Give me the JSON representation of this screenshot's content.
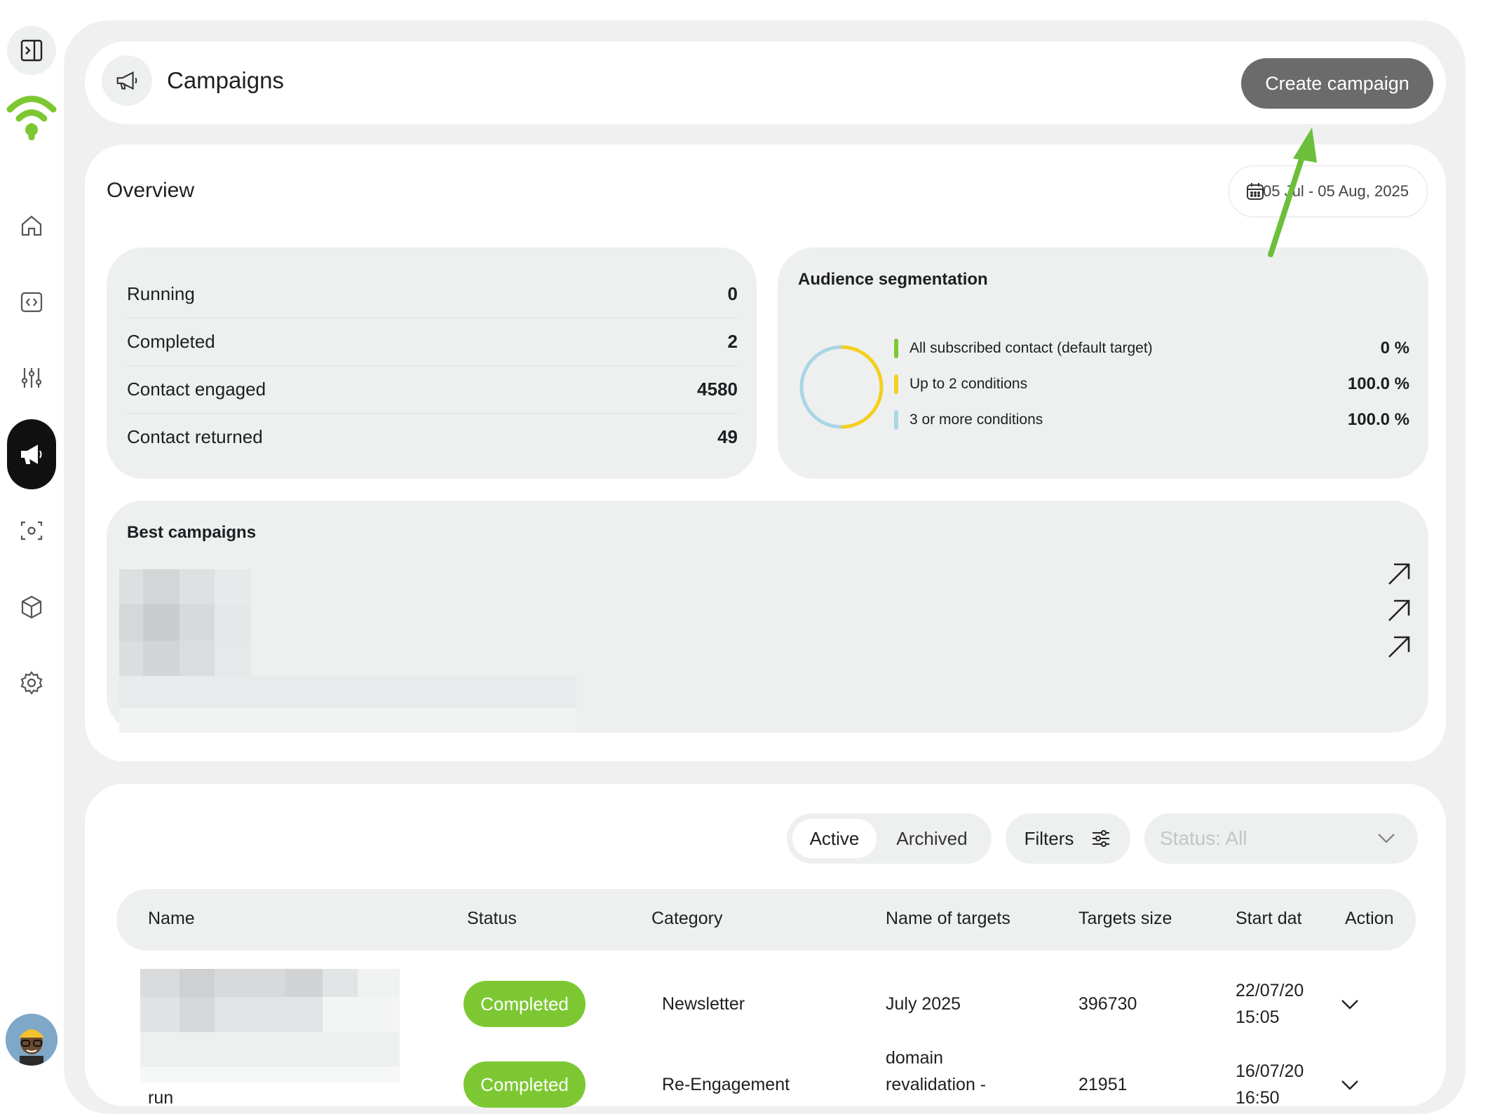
{
  "sidebar": {
    "toggle_icon": "sidebar-toggle-icon",
    "logo_icon": "wifi-logo-icon",
    "items": [
      {
        "name": "home",
        "icon": "home-icon"
      },
      {
        "name": "code",
        "icon": "code-icon"
      },
      {
        "name": "sliders",
        "icon": "sliders-icon"
      },
      {
        "name": "campaigns",
        "icon": "megaphone-icon",
        "active": true
      },
      {
        "name": "scan",
        "icon": "scan-icon"
      },
      {
        "name": "box",
        "icon": "cube-icon"
      },
      {
        "name": "settings",
        "icon": "gear-icon"
      }
    ]
  },
  "header": {
    "title": "Campaigns",
    "create_label": "Create campaign"
  },
  "overview": {
    "title": "Overview",
    "date_range": "05 Jul - 05 Aug, 2025",
    "stats": [
      {
        "label": "Running",
        "value": "0"
      },
      {
        "label": "Completed",
        "value": "2"
      },
      {
        "label": "Contact engaged",
        "value": "4580"
      },
      {
        "label": "Contact returned",
        "value": "49"
      }
    ]
  },
  "audience": {
    "title": "Audience segmentation",
    "legend": [
      {
        "label": "All subscribed contact (default target)",
        "value": "0 %",
        "color": "#7dc832"
      },
      {
        "label": "Up to 2 conditions",
        "value": "100.0 %",
        "color": "#f5cf1e"
      },
      {
        "label": "3 or more conditions",
        "value": "100.0 %",
        "color": "#a9d6e5"
      }
    ]
  },
  "best": {
    "title": "Best campaigns"
  },
  "table": {
    "tab_active": "Active",
    "tab_archived": "Archived",
    "filters_label": "Filters",
    "status_placeholder": "Status: All",
    "columns": [
      "Name",
      "Status",
      "Category",
      "Name of targets",
      "Targets size",
      "Start dat",
      "Action"
    ],
    "rows": [
      {
        "name": "",
        "status": "Completed",
        "category": "Newsletter",
        "targets": "July 2025",
        "size": "396730",
        "date": "22/07/20",
        "time": "15:05"
      },
      {
        "name": "run",
        "status": "Completed",
        "category": "Re-Engagement",
        "targets_1": "domain",
        "targets_2": "revalidation -",
        "size": "21951",
        "date": "16/07/20",
        "time": "16:50"
      }
    ]
  },
  "colors": {
    "accent_green": "#7dc832",
    "button_gray": "#6b6b6b",
    "annotation_arrow": "#6cbf3a"
  }
}
